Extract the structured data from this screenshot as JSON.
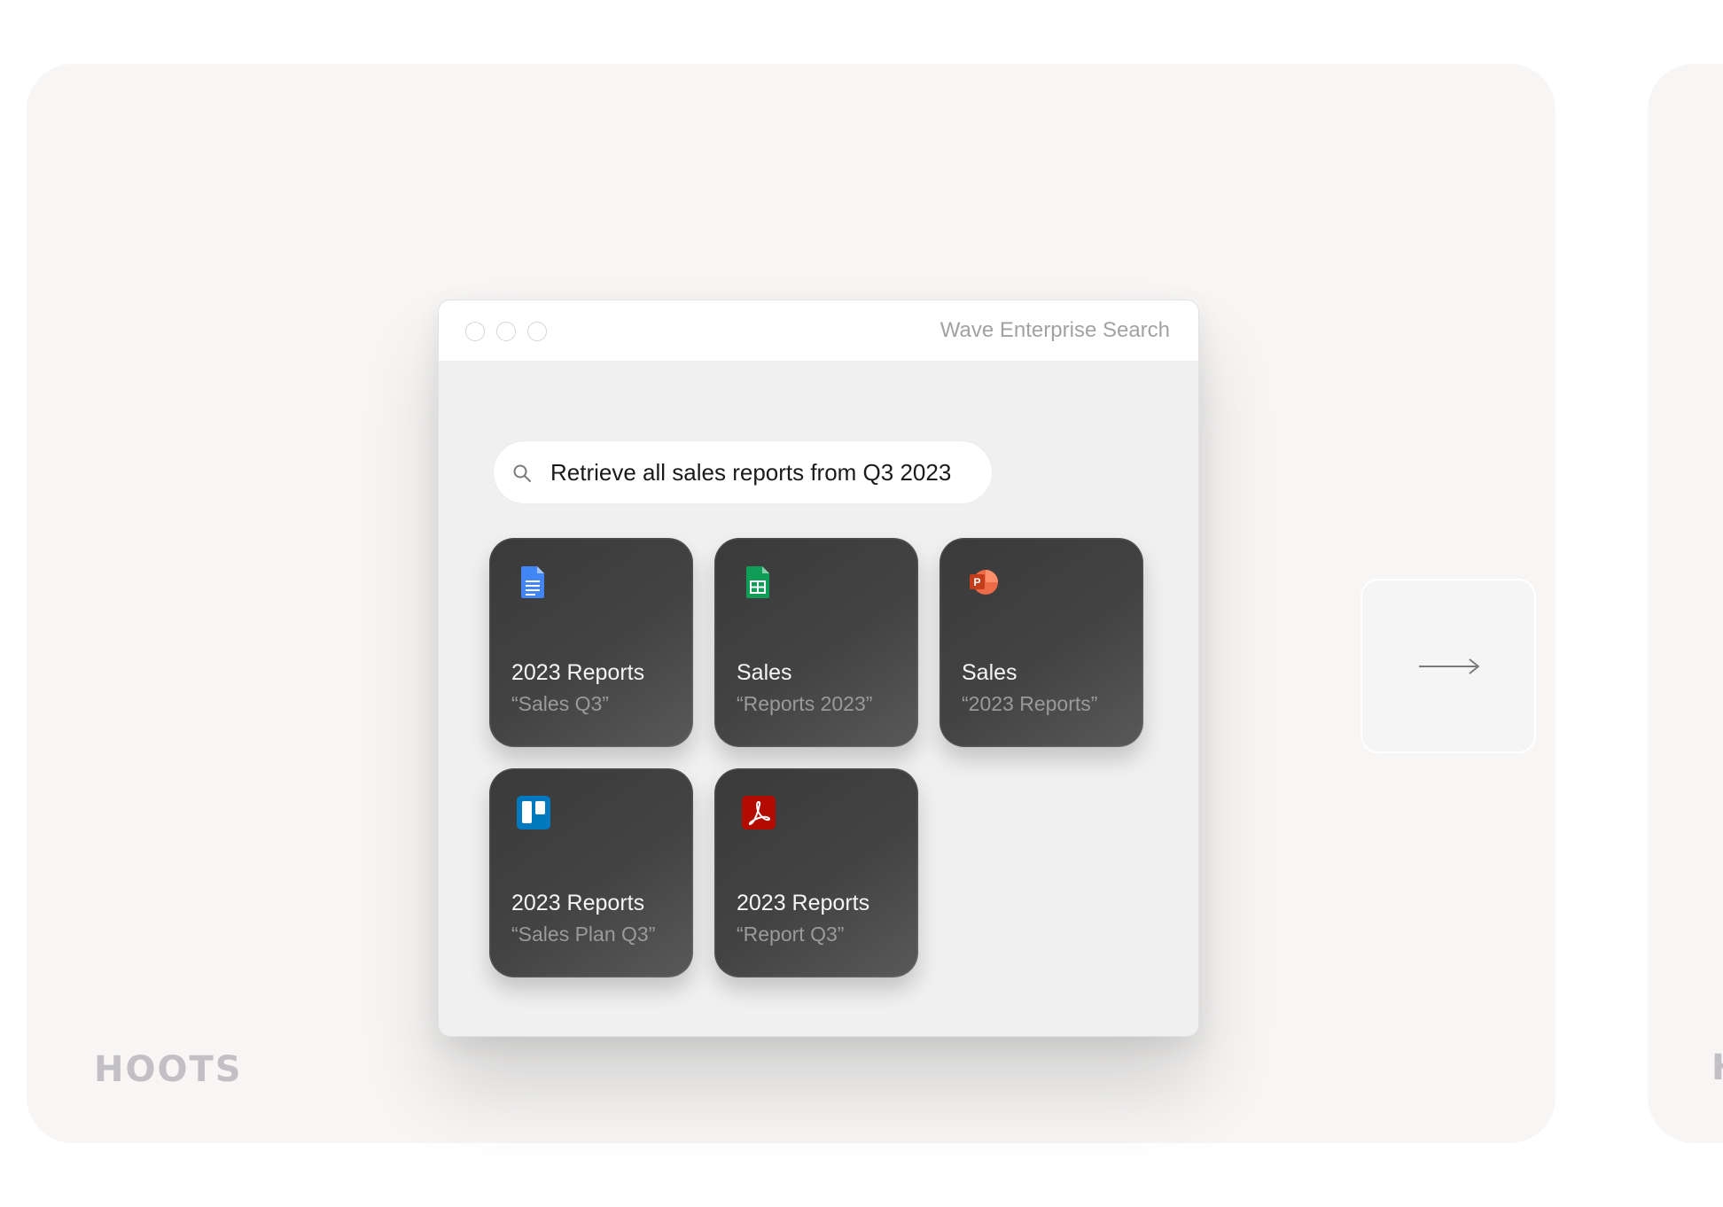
{
  "window": {
    "title": "Wave Enterprise Search"
  },
  "search": {
    "query": "Retrieve all sales reports from Q3 2023"
  },
  "results": [
    {
      "icon": "google-docs-icon",
      "title": "2023 Reports",
      "subtitle": "“Sales Q3”"
    },
    {
      "icon": "google-sheets-icon",
      "title": "Sales",
      "subtitle": "“Reports 2023”"
    },
    {
      "icon": "powerpoint-icon",
      "title": "Sales",
      "subtitle": "“2023 Reports”"
    },
    {
      "icon": "trello-icon",
      "title": "2023 Reports",
      "subtitle": "“Sales Plan Q3”"
    },
    {
      "icon": "adobe-acrobat-icon",
      "title": "2023 Reports",
      "subtitle": "“Report Q3”"
    }
  ],
  "navigation": {
    "next_icon": "arrow-right-icon"
  },
  "brand": {
    "name": "HOOTS",
    "next_partial": "H"
  },
  "colors": {
    "card_background": "#f7f6f5",
    "tile_background": "#3f3f3f",
    "docs_blue": "#4285f4",
    "sheets_green": "#0f9d58",
    "powerpoint_red": "#d24726",
    "trello_blue": "#0079bf",
    "acrobat_red": "#b30b00",
    "brand_gray": "#c2c0c4"
  }
}
